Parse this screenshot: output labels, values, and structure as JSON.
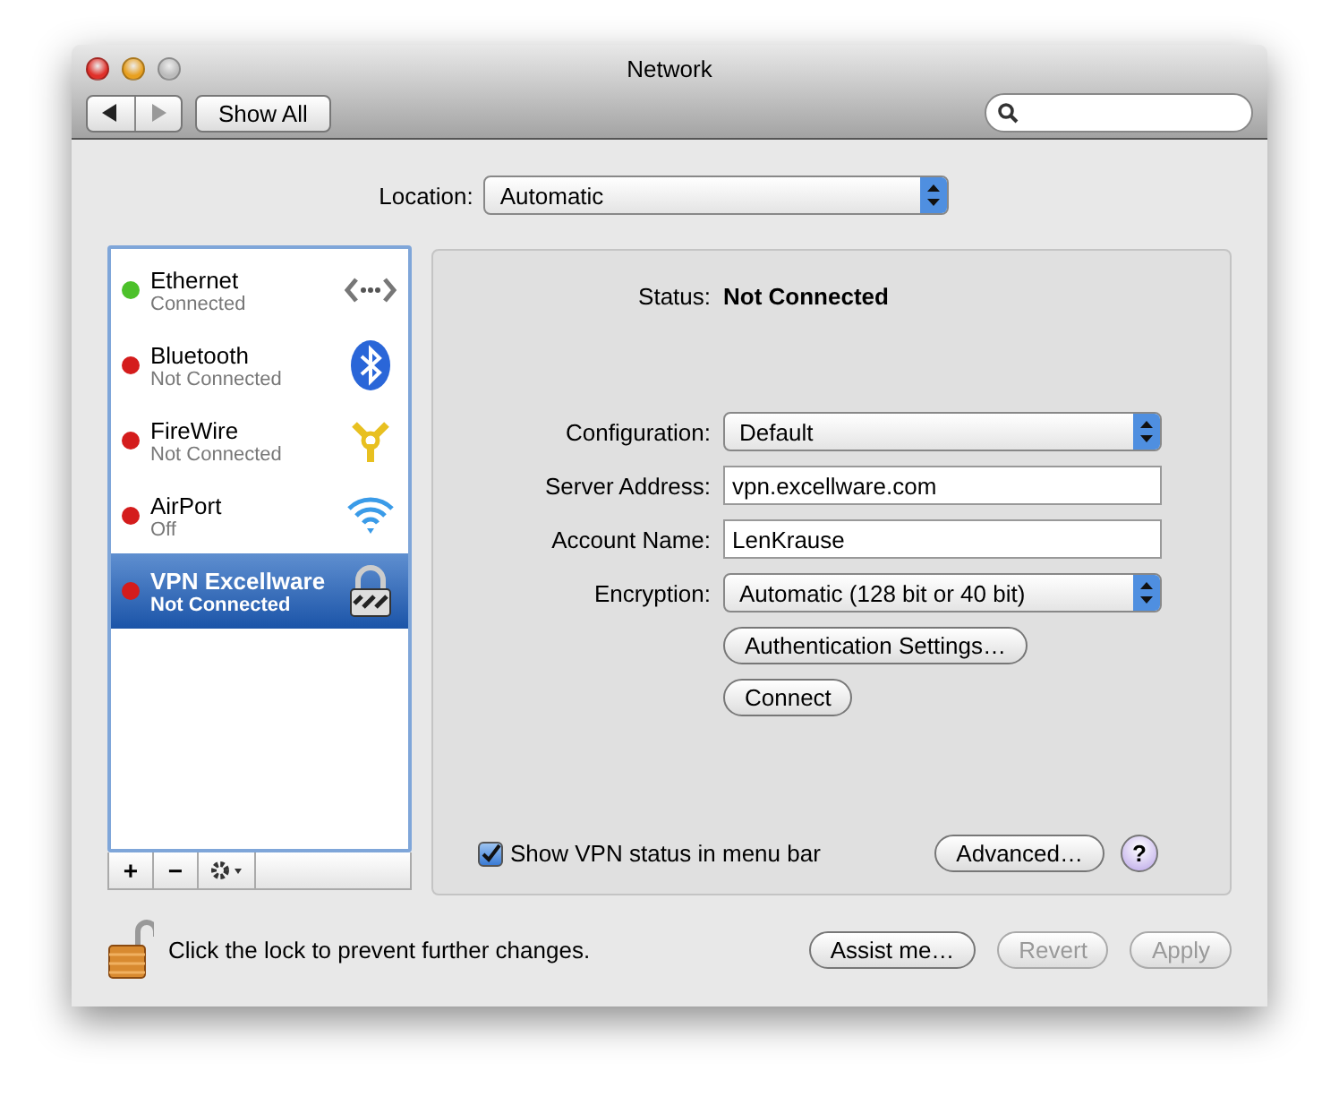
{
  "window": {
    "title": "Network"
  },
  "toolbar": {
    "show_all": "Show All"
  },
  "location": {
    "label": "Location:",
    "value": "Automatic"
  },
  "services": [
    {
      "name": "Ethernet",
      "status": "Connected",
      "color": "#4cc12a",
      "selected": false,
      "kind": "ethernet"
    },
    {
      "name": "Bluetooth",
      "status": "Not Connected",
      "color": "#d41c1c",
      "selected": false,
      "kind": "bluetooth"
    },
    {
      "name": "FireWire",
      "status": "Not Connected",
      "color": "#d41c1c",
      "selected": false,
      "kind": "firewire"
    },
    {
      "name": "AirPort",
      "status": "Off",
      "color": "#d41c1c",
      "selected": false,
      "kind": "airport"
    },
    {
      "name": "VPN Excellware",
      "status": "Not Connected",
      "color": "#d41c1c",
      "selected": true,
      "kind": "vpn"
    }
  ],
  "list_buttons": [
    "+",
    "−"
  ],
  "status": {
    "label": "Status:",
    "value": "Not Connected"
  },
  "form": [
    {
      "kind": "popup",
      "label": "Configuration:",
      "value": "Default"
    },
    {
      "kind": "text",
      "label": "Server Address:",
      "value": "vpn.excellware.com"
    },
    {
      "kind": "text",
      "label": "Account Name:",
      "value": "LenKrause"
    },
    {
      "kind": "popup",
      "label": "Encryption:",
      "value": "Automatic (128 bit or 40 bit)"
    },
    {
      "kind": "button",
      "label": "Authentication Settings…"
    },
    {
      "kind": "button",
      "label": "Connect"
    }
  ],
  "show_status": {
    "label": "Show VPN status in menu bar",
    "checked": true
  },
  "advanced": "Advanced…",
  "help": "?",
  "lock": {
    "text": "Click the lock to prevent further changes.",
    "locked": false
  },
  "footer_buttons": [
    {
      "label": "Assist me…",
      "disabled": false
    },
    {
      "label": "Revert",
      "disabled": true
    },
    {
      "label": "Apply",
      "disabled": true
    }
  ]
}
